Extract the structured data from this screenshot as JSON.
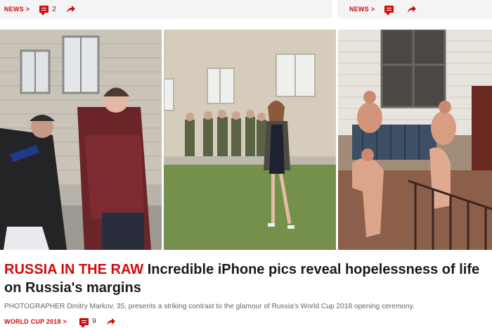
{
  "top_left": {
    "channel": "NEWS",
    "comments": "2",
    "share_icon": "share-arrow-icon"
  },
  "top_right": {
    "channel": "NEWS",
    "comments": "",
    "share_icon": "share-arrow-icon"
  },
  "article": {
    "kicker": "RUSSIA IN THE RAW",
    "title": "Incredible iPhone pics reveal hopelessness of life on Russia's margins",
    "standfirst": "PHOTOGRAPHER Dmitry Markov, 35, presents a striking contrast to the glamour of Russia's World Cup 2018 opening ceremony.",
    "channel": "WORLD CUP 2018",
    "comments": "9",
    "share_icon": "share-arrow-icon"
  },
  "colors": {
    "accent": "#d10b0b",
    "text": "#1a1a1a",
    "muted": "#666666"
  }
}
